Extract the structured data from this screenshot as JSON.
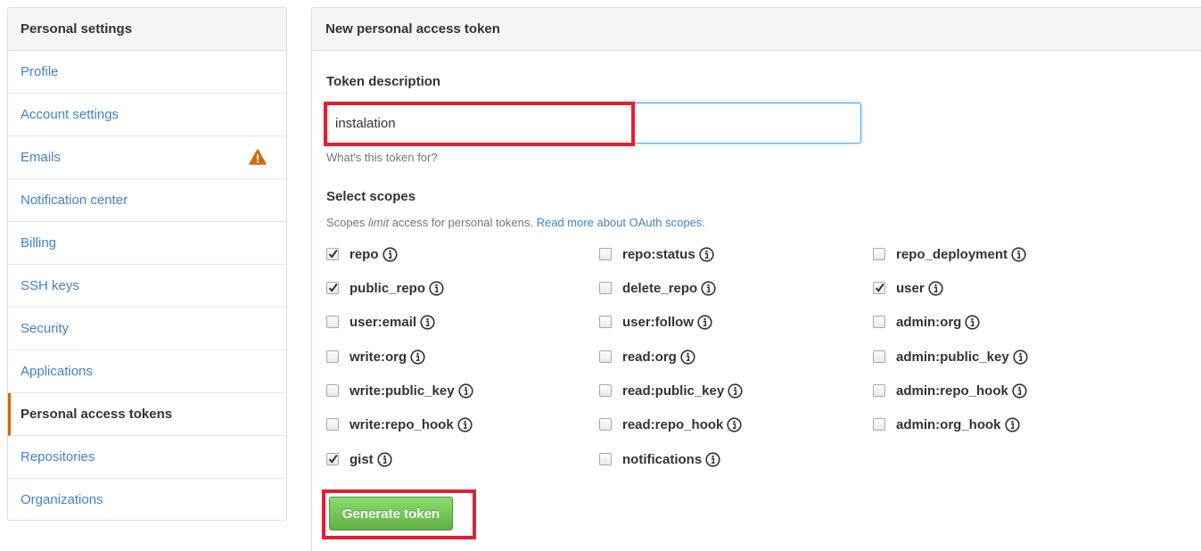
{
  "sidebar": {
    "header": "Personal settings",
    "items": [
      {
        "label": "Profile"
      },
      {
        "label": "Account settings"
      },
      {
        "label": "Emails"
      },
      {
        "label": "Notification center"
      },
      {
        "label": "Billing"
      },
      {
        "label": "SSH keys"
      },
      {
        "label": "Security"
      },
      {
        "label": "Applications"
      },
      {
        "label": "Personal access tokens"
      },
      {
        "label": "Repositories"
      },
      {
        "label": "Organizations"
      }
    ],
    "selected_item": "Personal access tokens",
    "warning_item": "Emails",
    "warning_color": "#d26911"
  },
  "main": {
    "title": "New personal access token",
    "description_label": "Token description",
    "description_value": "instalation",
    "description_hint": "What's this token for?",
    "scopes_label": "Select scopes",
    "scopes_note_prefix": "Scopes ",
    "scopes_note_emphasis": "limit",
    "scopes_note_suffix": " access for personal tokens. ",
    "scopes_note_link": "Read more about OAuth scopes.",
    "scopes": [
      {
        "name": "repo",
        "checked": true
      },
      {
        "name": "repo:status",
        "checked": false
      },
      {
        "name": "repo_deployment",
        "checked": false
      },
      {
        "name": "public_repo",
        "checked": true
      },
      {
        "name": "delete_repo",
        "checked": false
      },
      {
        "name": "user",
        "checked": true
      },
      {
        "name": "user:email",
        "checked": false
      },
      {
        "name": "user:follow",
        "checked": false
      },
      {
        "name": "admin:org",
        "checked": false
      },
      {
        "name": "write:org",
        "checked": false
      },
      {
        "name": "read:org",
        "checked": false
      },
      {
        "name": "admin:public_key",
        "checked": false
      },
      {
        "name": "write:public_key",
        "checked": false
      },
      {
        "name": "read:public_key",
        "checked": false
      },
      {
        "name": "admin:repo_hook",
        "checked": false
      },
      {
        "name": "write:repo_hook",
        "checked": false
      },
      {
        "name": "read:repo_hook",
        "checked": false
      },
      {
        "name": "admin:org_hook",
        "checked": false
      },
      {
        "name": "gist",
        "checked": true
      },
      {
        "name": "notifications",
        "checked": false
      }
    ],
    "generate_label": "Generate token"
  },
  "colors": {
    "link": "#4183c4",
    "highlight": "#e0202e",
    "button": "#6cc644"
  }
}
